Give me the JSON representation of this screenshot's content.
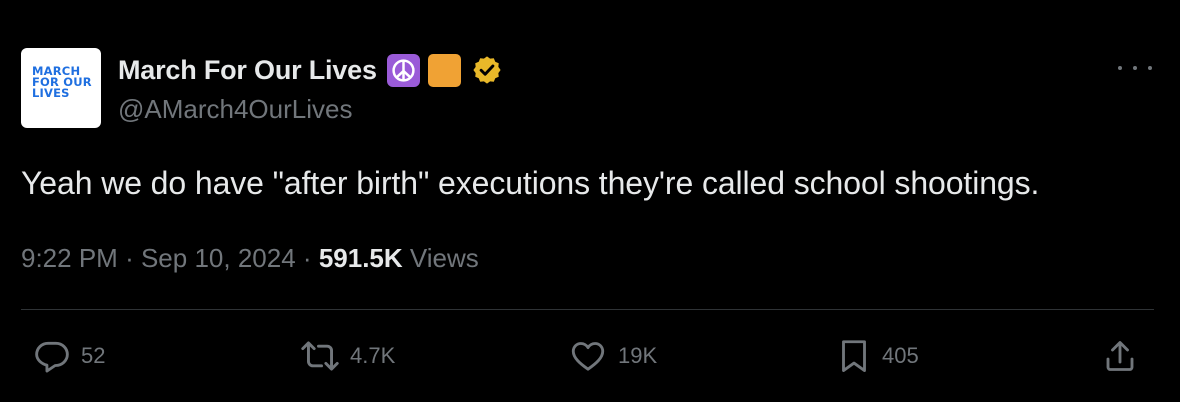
{
  "author": {
    "avatar_lines": [
      "MARCH",
      "FOR OUR",
      "LIVES"
    ],
    "display_name": "March For Our Lives",
    "emojis": [
      "peace-symbol-icon",
      "orange-square-icon"
    ],
    "verified_icon": "gold-verified-badge-icon",
    "handle": "@AMarch4OurLives"
  },
  "tweet": {
    "text": "Yeah we do have \"after birth\" executions they're called school shootings.",
    "time": "9:22 PM",
    "separator": "·",
    "date": "Sep 10, 2024",
    "views_count": "591.5K",
    "views_label": "Views"
  },
  "actions": {
    "replies": "52",
    "reposts": "4.7K",
    "likes": "19K",
    "bookmarks": "405"
  },
  "colors": {
    "background": "#000000",
    "text": "#e7e9ea",
    "secondary": "#71767b",
    "divider": "#2f3336",
    "verified": "#e8b829",
    "avatar_blue": "#1f6fe0"
  }
}
